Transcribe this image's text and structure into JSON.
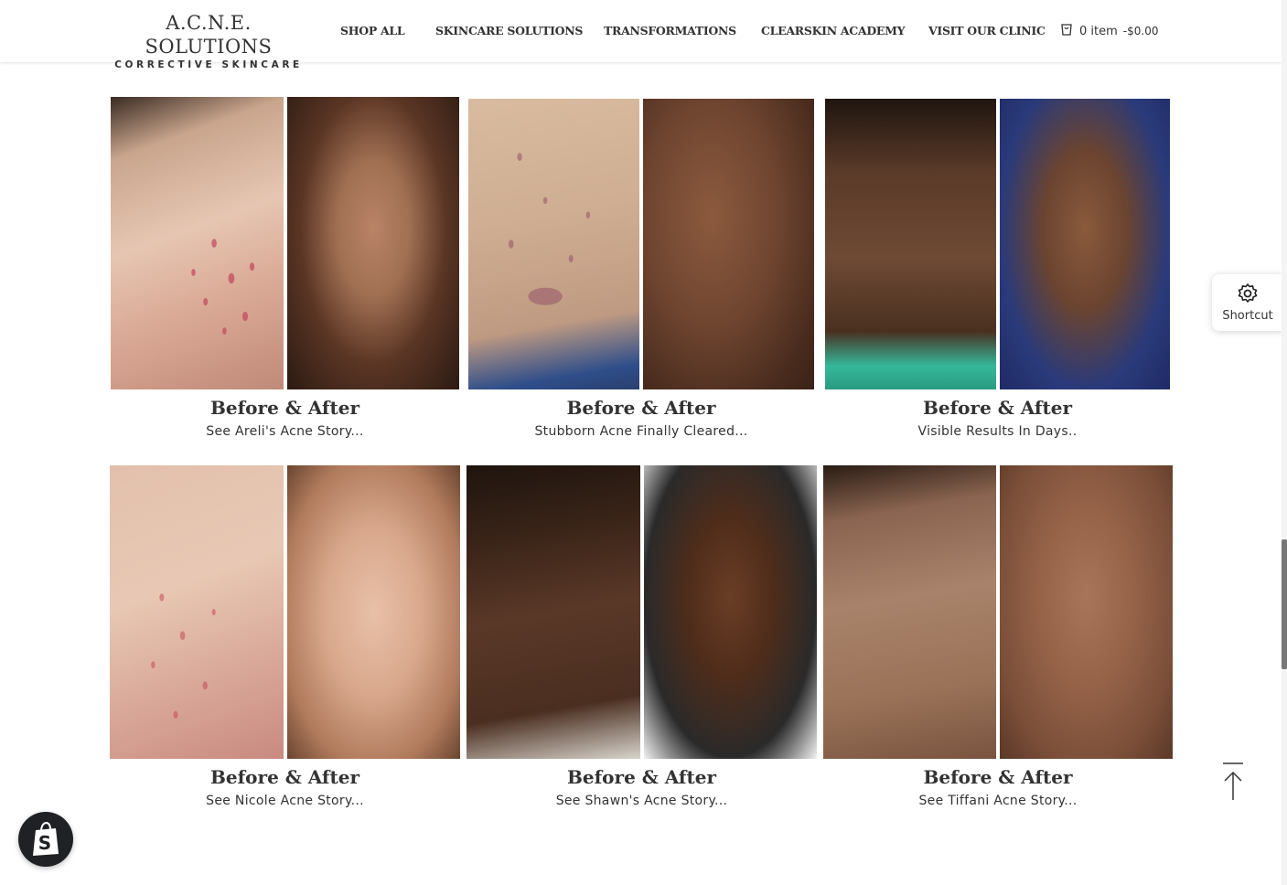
{
  "header": {
    "logo_title": "A.C.N.E. SOLUTIONS",
    "logo_subtitle": "CORRECTIVE SKINCARE",
    "nav": [
      {
        "label": "SHOP ALL"
      },
      {
        "label": "SKINCARE SOLUTIONS"
      },
      {
        "label": "TRANSFORMATIONS"
      },
      {
        "label": "CLEARSKIN ACADEMY"
      },
      {
        "label": "VISIT OUR CLINIC"
      }
    ],
    "cart": {
      "icon": "cart-icon",
      "count": "0 item",
      "total": "-$0.00"
    }
  },
  "cards": [
    {
      "title": "Before & After",
      "subtitle": "See Areli's Acne Story..."
    },
    {
      "title": "Before & After",
      "subtitle": "Stubborn Acne Finally Cleared..."
    },
    {
      "title": "Before & After",
      "subtitle": "Visible Results In Days.."
    },
    {
      "title": "Before & After",
      "subtitle": "See Nicole Acne Story..."
    },
    {
      "title": "Before & After",
      "subtitle": "See Shawn's Acne Story..."
    },
    {
      "title": "Before & After",
      "subtitle": "See Tiffani Acne Story..."
    }
  ],
  "shortcut": {
    "icon": "gear-icon",
    "label": "Shortcut"
  },
  "back_to_top": {
    "icon": "arrow-up-icon"
  },
  "shopify": {
    "icon": "shopify-bag-icon"
  }
}
